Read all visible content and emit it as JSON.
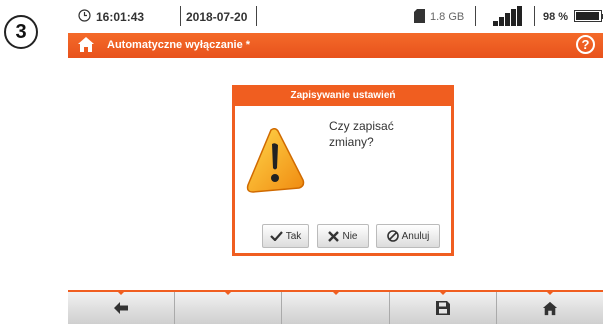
{
  "step_badge": "3",
  "status": {
    "time": "16:01:43",
    "date": "2018-07-20",
    "storage": "1.8 GB",
    "battery": "98 %"
  },
  "titlebar": {
    "title": "Automatyczne wyłączanie *",
    "help_icon": "?"
  },
  "dialog": {
    "title": "Zapisywanie ustawień",
    "message": "Czy zapisać\nzmiany?",
    "buttons": {
      "yes": "Tak",
      "no": "Nie",
      "cancel": "Anuluj"
    }
  },
  "bottombar": {
    "icons": [
      "back-arrow-icon",
      "",
      "",
      "save-icon",
      "home-icon"
    ]
  },
  "colors": {
    "accent": "#f05e20"
  }
}
